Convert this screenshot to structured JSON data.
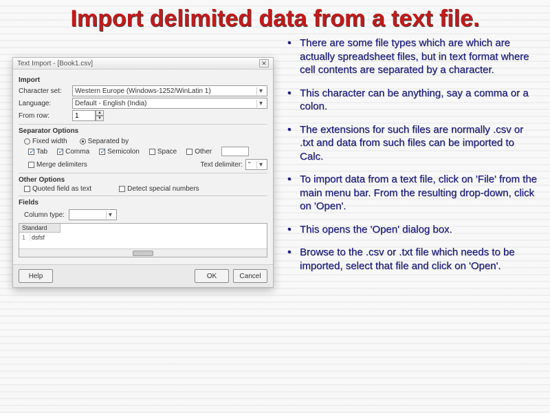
{
  "title": "Import delimited data from a text file.",
  "bullets": [
    "There are some file types which are which are actually spreadsheet files, but in text format where cell contents are separated by a character.",
    "This character can be anything, say a comma or a colon.",
    "The extensions for such files are normally .csv or .txt and data from such files can be imported to Calc.",
    "To import data from a text file, click on 'File' from the main menu bar. From the resulting drop-down, click on 'Open'.",
    "This opens the 'Open' dialog box.",
    "Browse to the .csv or .txt file which needs to be imported, select that file and click on 'Open'."
  ],
  "dialog": {
    "title": "Text Import - [Book1.csv]",
    "sections": {
      "import": "Import",
      "separator": "Separator Options",
      "other": "Other Options",
      "fields": "Fields"
    },
    "labels": {
      "charset": "Character set:",
      "language": "Language:",
      "fromrow": "From row:",
      "fixedwidth": "Fixed width",
      "separatedby": "Separated by",
      "tab": "Tab",
      "comma": "Comma",
      "semicolon": "Semicolon",
      "space": "Space",
      "otherchk": "Other",
      "merge": "Merge delimiters",
      "textdelim": "Text delimiter:",
      "quoted": "Quoted field as text",
      "detect": "Detect special numbers",
      "coltype": "Column type:",
      "previewHeader": "Standard",
      "help": "Help",
      "ok": "OK",
      "cancel": "Cancel"
    },
    "values": {
      "charset": "Western Europe (Windows-1252/WinLatin 1)",
      "language": "Default - English (India)",
      "fromrow": "1",
      "coltype": "",
      "textdelim": "\"",
      "previewRow1": "dsfsf"
    },
    "state": {
      "separatedBy": true,
      "tab": true,
      "comma": true,
      "semicolon": true,
      "space": false,
      "other": false,
      "merge": false,
      "quoted": false,
      "detect": false
    }
  }
}
